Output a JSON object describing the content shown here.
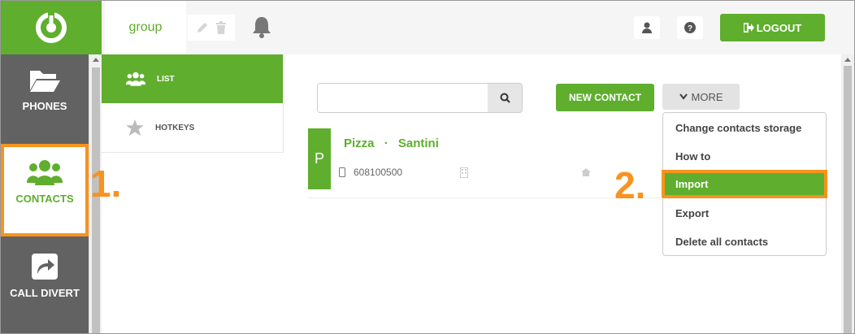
{
  "nav": {
    "phones_label": "PHONES",
    "contacts_label": "CONTACTS",
    "call_divert_label": "CALL DIVERT"
  },
  "topbar": {
    "group_label": "group",
    "logout_label": "LOGOUT"
  },
  "submenu": {
    "list_label": "LIST",
    "hotkeys_label": "HOTKEYS"
  },
  "search": {
    "value": "",
    "placeholder": ""
  },
  "actions": {
    "new_contact_label": "NEW CONTACT",
    "more_label": "MORE"
  },
  "more_menu": {
    "items": [
      "Change contacts storage",
      "How to",
      "Import",
      "Export",
      "Delete all contacts"
    ]
  },
  "contact": {
    "initial": "P",
    "first_name": "Pizza",
    "separator": "·",
    "last_name": "Santini",
    "phone": "608100500"
  },
  "annotations": {
    "step1": "1.",
    "step2": "2."
  },
  "colors": {
    "brand_green": "#5fae2e",
    "highlight_orange": "#f7931e",
    "nav_gray": "#626262"
  }
}
